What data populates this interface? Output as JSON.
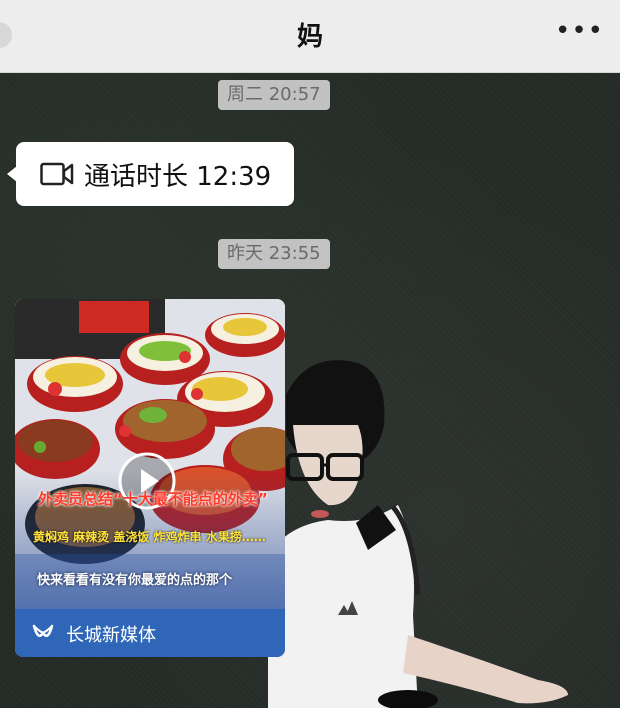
{
  "header": {
    "title": "妈",
    "more": "•••"
  },
  "messages": [
    {
      "timestamp": "周二 20:57",
      "call_label": "通话时长 12:39"
    },
    {
      "timestamp": "昨天 23:55",
      "video": {
        "headline": "外卖员总结“十大最不能点的外卖”",
        "food_list": "黄焖鸡 麻辣烫 盖浇饭 炸鸡炸串 水果捞……",
        "prompt": "快来看看有没有你最爱的点的那个",
        "source": "长城新媒体"
      }
    }
  ],
  "colors": {
    "header_bg": "#ededed",
    "bubble_bg": "#ffffff",
    "timestamp_bg": "#dcdcdc",
    "source_bar": "#2f66b8",
    "headline_red": "#ff3a2a",
    "foodlist_yellow": "#ffe23a"
  },
  "icons": [
    "video-call-icon",
    "play-icon",
    "more-icon",
    "channel-logo-icon"
  ]
}
